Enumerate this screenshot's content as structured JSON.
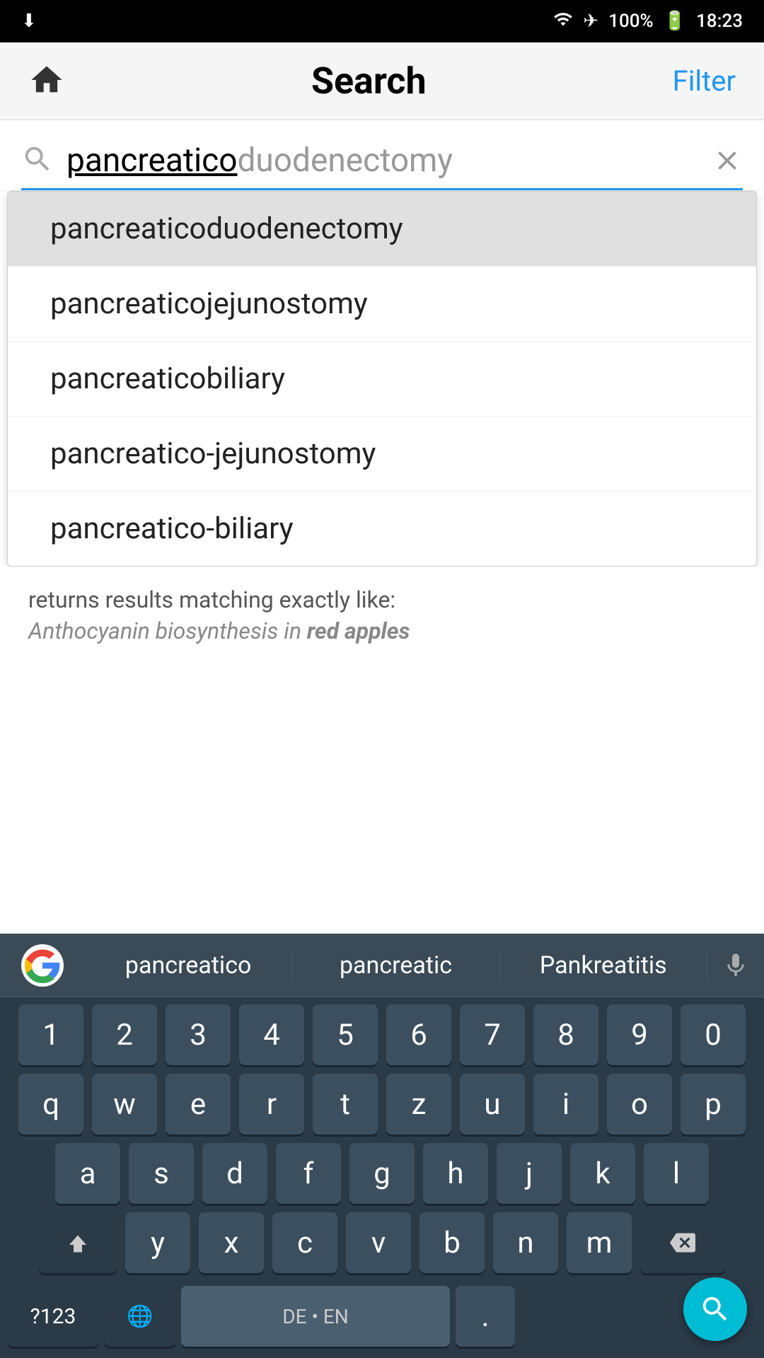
{
  "statusBar": {
    "battery": "100%",
    "time": "18:23",
    "download_icon": "download-icon",
    "wifi_icon": "wifi-icon",
    "airplane_icon": "airplane-icon",
    "battery_icon": "battery-icon"
  },
  "header": {
    "title": "Search",
    "filter_label": "Filter",
    "home_icon": "home-icon"
  },
  "searchBar": {
    "typed_text": "pancreatico",
    "ghost_text": "duodenectomy",
    "clear_icon": "clear-icon",
    "search_icon": "search-icon"
  },
  "autocomplete": {
    "items": [
      {
        "label": "pancreaticoduodenectomy",
        "selected": true
      },
      {
        "label": "pancreaticojejunostomy",
        "selected": false
      },
      {
        "label": "pancreaticobiliary",
        "selected": false
      },
      {
        "label": "pancreatico-jejunostomy",
        "selected": false
      },
      {
        "label": "pancreatico-biliary",
        "selected": false
      }
    ]
  },
  "infoSection": {
    "description": "returns results matching exactly like:",
    "example_prefix": "Anthocyanin biosynthesis in ",
    "example_bold": "red apples"
  },
  "keyboard": {
    "suggestions": [
      "pancreatico",
      "pancreatic",
      "Pankreatitis"
    ],
    "rows": [
      [
        "1",
        "2",
        "3",
        "4",
        "5",
        "6",
        "7",
        "8",
        "9",
        "0"
      ],
      [
        "q",
        "w",
        "e",
        "r",
        "t",
        "z",
        "u",
        "i",
        "o",
        "p"
      ],
      [
        "a",
        "s",
        "d",
        "f",
        "g",
        "h",
        "j",
        "k",
        "l"
      ],
      [
        "⇧",
        "y",
        "x",
        "c",
        "v",
        "b",
        "n",
        "m",
        "⌫"
      ],
      [
        "?123",
        "🌐",
        "DE • EN",
        ".",
        ""
      ]
    ],
    "num_label": "?123",
    "globe_label": "🌐",
    "lang_label": "DE • EN",
    "period_label": ".",
    "mic_icon": "microphone-icon",
    "search_action_icon": "search-action-icon"
  }
}
